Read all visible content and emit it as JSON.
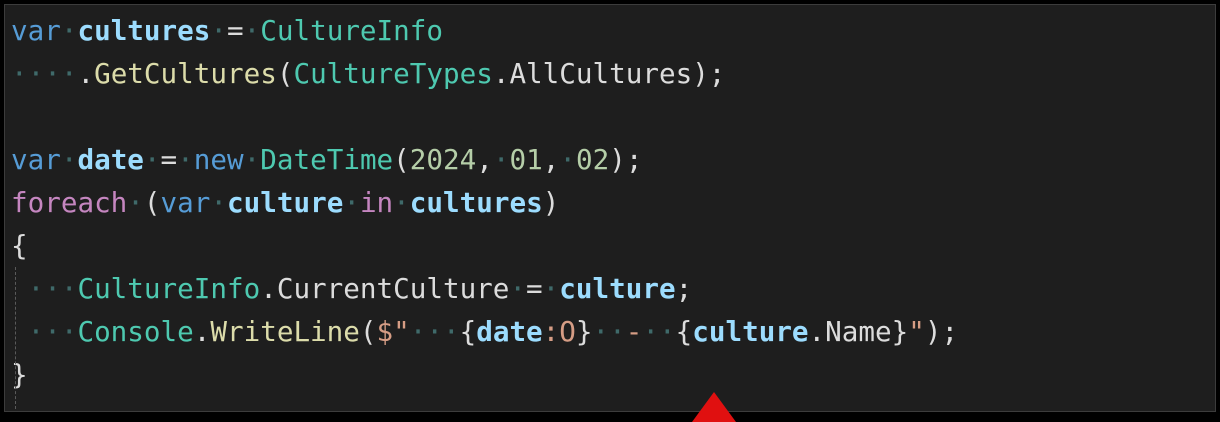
{
  "editor": {
    "theme_colors": {
      "background": "#1e1e1e",
      "keyword": "#569cd6",
      "control_keyword": "#c586c0",
      "type": "#4ec9b0",
      "identifier": "#9cdcfe",
      "method": "#dcdcaa",
      "number": "#b5cea8",
      "string": "#d69d85",
      "arrow": "#e01010"
    },
    "lines": [
      {
        "tokens": [
          {
            "t": "kw",
            "v": "var"
          },
          {
            "t": "ws",
            "v": "·"
          },
          {
            "t": "ident",
            "v": "cultures"
          },
          {
            "t": "ws",
            "v": "·"
          },
          {
            "t": "punc",
            "v": "="
          },
          {
            "t": "ws",
            "v": "·"
          },
          {
            "t": "type",
            "v": "CultureInfo"
          }
        ]
      },
      {
        "tokens": [
          {
            "t": "ws",
            "v": "····"
          },
          {
            "t": "punc",
            "v": "."
          },
          {
            "t": "member",
            "v": "GetCultures"
          },
          {
            "t": "punc",
            "v": "("
          },
          {
            "t": "type",
            "v": "CultureTypes"
          },
          {
            "t": "punc",
            "v": "."
          },
          {
            "t": "prop",
            "v": "AllCultures"
          },
          {
            "t": "punc",
            "v": ");"
          }
        ]
      },
      {
        "tokens": []
      },
      {
        "tokens": [
          {
            "t": "kw",
            "v": "var"
          },
          {
            "t": "ws",
            "v": "·"
          },
          {
            "t": "ident",
            "v": "date"
          },
          {
            "t": "ws",
            "v": "·"
          },
          {
            "t": "punc",
            "v": "="
          },
          {
            "t": "ws",
            "v": "·"
          },
          {
            "t": "kw",
            "v": "new"
          },
          {
            "t": "ws",
            "v": "·"
          },
          {
            "t": "type",
            "v": "DateTime"
          },
          {
            "t": "punc",
            "v": "("
          },
          {
            "t": "num",
            "v": "2024"
          },
          {
            "t": "punc",
            "v": ","
          },
          {
            "t": "ws",
            "v": "·"
          },
          {
            "t": "num",
            "v": "01"
          },
          {
            "t": "punc",
            "v": ","
          },
          {
            "t": "ws",
            "v": "·"
          },
          {
            "t": "num",
            "v": "02"
          },
          {
            "t": "punc",
            "v": ");"
          }
        ]
      },
      {
        "tokens": [
          {
            "t": "kw2",
            "v": "foreach"
          },
          {
            "t": "ws",
            "v": "·"
          },
          {
            "t": "punc",
            "v": "("
          },
          {
            "t": "kw",
            "v": "var"
          },
          {
            "t": "ws",
            "v": "·"
          },
          {
            "t": "ident",
            "v": "culture"
          },
          {
            "t": "ws",
            "v": "·"
          },
          {
            "t": "kw2",
            "v": "in"
          },
          {
            "t": "ws",
            "v": "·"
          },
          {
            "t": "ident",
            "v": "cultures"
          },
          {
            "t": "punc",
            "v": ")"
          }
        ]
      },
      {
        "tokens": [
          {
            "t": "punc",
            "v": "{"
          }
        ]
      },
      {
        "tokens": [
          {
            "t": "ws",
            "v": " ···"
          },
          {
            "t": "type",
            "v": "CultureInfo"
          },
          {
            "t": "punc",
            "v": "."
          },
          {
            "t": "prop",
            "v": "CurrentCulture"
          },
          {
            "t": "ws",
            "v": "·"
          },
          {
            "t": "punc",
            "v": "="
          },
          {
            "t": "ws",
            "v": "·"
          },
          {
            "t": "ident",
            "v": "culture"
          },
          {
            "t": "punc",
            "v": ";"
          }
        ]
      },
      {
        "tokens": [
          {
            "t": "ws",
            "v": " ···"
          },
          {
            "t": "type",
            "v": "Console"
          },
          {
            "t": "punc",
            "v": "."
          },
          {
            "t": "member",
            "v": "WriteLine"
          },
          {
            "t": "punc",
            "v": "("
          },
          {
            "t": "str",
            "v": "$\""
          },
          {
            "t": "ws",
            "v": "···"
          },
          {
            "t": "interp",
            "v": "{"
          },
          {
            "t": "ident",
            "v": "date"
          },
          {
            "t": "str",
            "v": ":O"
          },
          {
            "t": "interp",
            "v": "}"
          },
          {
            "t": "ws",
            "v": "··"
          },
          {
            "t": "str",
            "v": "-"
          },
          {
            "t": "ws",
            "v": "··"
          },
          {
            "t": "interp",
            "v": "{"
          },
          {
            "t": "ident",
            "v": "culture"
          },
          {
            "t": "punc",
            "v": "."
          },
          {
            "t": "prop",
            "v": "Name"
          },
          {
            "t": "interp",
            "v": "}"
          },
          {
            "t": "str",
            "v": "\""
          },
          {
            "t": "punc",
            "v": ");"
          }
        ]
      },
      {
        "tokens": [
          {
            "t": "punc",
            "v": "}"
          }
        ]
      }
    ]
  },
  "annotation": {
    "arrow_icon": "red-up-arrow-icon"
  }
}
